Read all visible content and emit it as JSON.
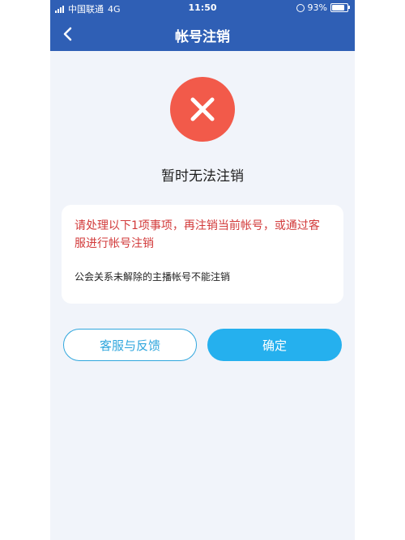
{
  "status_bar": {
    "carrier": "中国联通",
    "network": "4G",
    "time": "11:50",
    "battery": "93%"
  },
  "nav": {
    "title": "帐号注销",
    "back_icon": "chevron-left-icon"
  },
  "result": {
    "icon": "error-x-icon",
    "title": "暂时无法注销"
  },
  "card": {
    "warning": "请处理以下1项事项，再注销当前帐号，或通过客服进行帐号注销",
    "detail": "公会关系未解除的主播帐号不能注销"
  },
  "buttons": {
    "feedback": "客服与反馈",
    "confirm": "确定"
  },
  "colors": {
    "nav_bg": "#2f5fb5",
    "error": "#f25a4a",
    "warning_text": "#d23a3a",
    "accent": "#25b0ee",
    "page_bg": "#f1f4fa"
  }
}
